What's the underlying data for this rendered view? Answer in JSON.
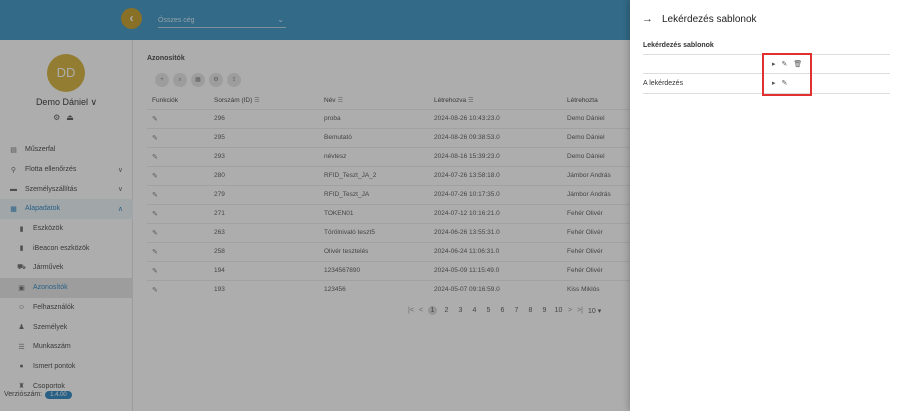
{
  "header": {
    "org_select_placeholder": "Összes cég"
  },
  "sidebar": {
    "avatar_initials": "DD",
    "user_name": "Demo Dániel ∨",
    "items": [
      {
        "label": "Műszerfal",
        "icon": "dashboard-icon"
      },
      {
        "label": "Flotta ellenőrzés",
        "icon": "fleet-icon",
        "expand": "∨"
      },
      {
        "label": "Személyszállítás",
        "icon": "bus-icon",
        "expand": "∨"
      },
      {
        "label": "Alapadatok",
        "icon": "data-icon",
        "expand": "∧"
      },
      {
        "label": "Eszközök",
        "icon": "device-icon"
      },
      {
        "label": "iBeacon eszközök",
        "icon": "beacon-icon"
      },
      {
        "label": "Járművek",
        "icon": "vehicle-icon"
      },
      {
        "label": "Azonosítók",
        "icon": "id-card-icon"
      },
      {
        "label": "Felhasználók",
        "icon": "users-icon"
      },
      {
        "label": "Személyek",
        "icon": "person-icon"
      },
      {
        "label": "Munkaszám",
        "icon": "list-icon"
      },
      {
        "label": "Ismert pontok",
        "icon": "pin-icon"
      },
      {
        "label": "Csoportok",
        "icon": "group-icon"
      }
    ],
    "version_label": "Verziószám:",
    "version_value": "1.4.00"
  },
  "main": {
    "section_title": "Azonosítók",
    "columns": [
      "Funkciók",
      "Sorszám (ID)",
      "Név",
      "Létrehozva",
      "Létrehozta"
    ],
    "rows": [
      {
        "id": "296",
        "name": "proba",
        "created": "2024-08-26 10:43:23.0",
        "by": "Demo Dániel"
      },
      {
        "id": "295",
        "name": "Bemutató",
        "created": "2024-08-26 09:38:53.0",
        "by": "Demo Dániel"
      },
      {
        "id": "293",
        "name": "névtesz",
        "created": "2024-08-16 15:39:23.0",
        "by": "Demo Dániel"
      },
      {
        "id": "280",
        "name": "RFID_Teszt_JA_2",
        "created": "2024-07-26 13:58:18.0",
        "by": "Jámbor András"
      },
      {
        "id": "279",
        "name": "RFID_Teszt_JA",
        "created": "2024-07-26 10:17:35.0",
        "by": "Jámbor András"
      },
      {
        "id": "271",
        "name": "TOKEN01",
        "created": "2024-07-12 10:16:21.0",
        "by": "Fehér Olivér"
      },
      {
        "id": "263",
        "name": "Törölnivaló teszt5",
        "created": "2024-06-26 13:55:31.0",
        "by": "Fehér Olivér"
      },
      {
        "id": "258",
        "name": "Olivér tesztelés",
        "created": "2024-06-24 11:06:31.0",
        "by": "Fehér Olivér"
      },
      {
        "id": "194",
        "name": "1234567890",
        "created": "2024-05-09 11:15:49.0",
        "by": "Fehér Olivér"
      },
      {
        "id": "193",
        "name": "123456",
        "created": "2024-05-07 09:16:59.0",
        "by": "Kiss Miklós"
      }
    ],
    "pager": {
      "pages": [
        "1",
        "2",
        "3",
        "4",
        "5",
        "6",
        "7",
        "8",
        "9",
        "10"
      ],
      "current": "1",
      "per_page": "10 ▾"
    }
  },
  "panel": {
    "title": "Lekérdezés sablonok",
    "subtitle": "Lekérdezés sablonok",
    "rows": [
      {
        "label": ""
      },
      {
        "label": "A lekérdezés"
      }
    ]
  },
  "colors": {
    "header": "#4a9cc8",
    "accent": "#3b8fc4",
    "avatar": "#d8b84c",
    "highlight": "#e03030"
  }
}
